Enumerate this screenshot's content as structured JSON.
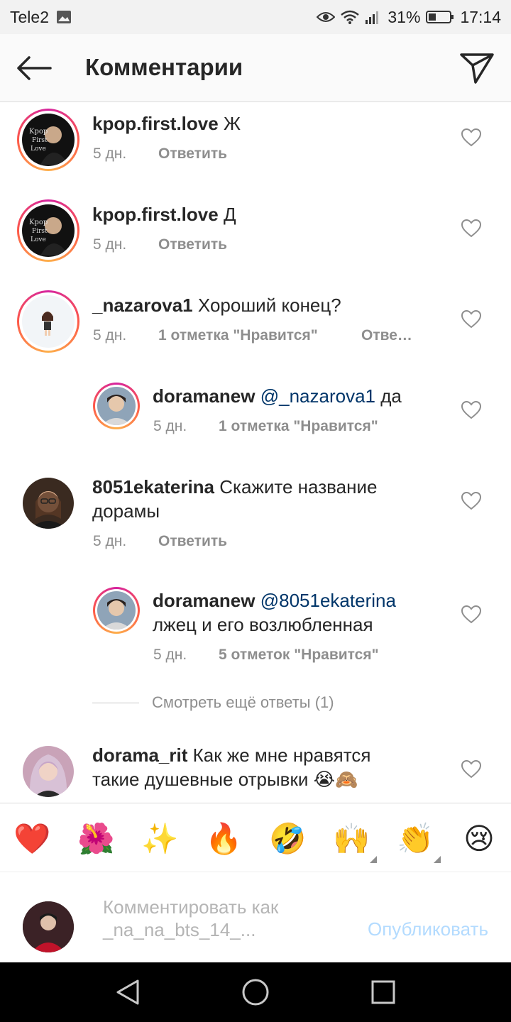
{
  "status_bar": {
    "carrier": "Tele2",
    "battery_percent": "31%",
    "time": "17:14"
  },
  "header": {
    "title": "Комментарии"
  },
  "comments": [
    {
      "username": "kpop.first.love",
      "text": "Ж",
      "time": "5 дн.",
      "action": "Ответить",
      "avatar_label": "Kpop First Love"
    },
    {
      "username": "kpop.first.love",
      "text": "Д",
      "time": "5 дн.",
      "action": "Ответить",
      "avatar_label": "Kpop First Love"
    },
    {
      "username": "_nazarova1",
      "text": "Хороший конец?",
      "time": "5 дн.",
      "likes": "1 отметка \"Нравится\"",
      "action": "Отве…"
    },
    {
      "username": "doramanew",
      "mention": "@_nazarova1",
      "text": "да",
      "time": "5 дн.",
      "likes": "1 отметка \"Нравится\"",
      "reply": true
    },
    {
      "username": "8051ekaterina",
      "text": "Скажите название",
      "text2": "дорамы",
      "time": "5 дн.",
      "action": "Ответить"
    },
    {
      "username": "doramanew",
      "mention": "@8051ekaterina",
      "text2": "лжец и его возлюбленная",
      "time": "5 дн.",
      "likes": "5 отметок \"Нравится\"",
      "reply": true
    },
    {
      "username": "dorama_rit",
      "text": "Как же мне нравятся",
      "text2": "такие душевные отрывки",
      "emojis": "😭🙈"
    }
  ],
  "more_replies": "Смотреть ещё ответы (1)",
  "emoji_bar": [
    "❤️",
    "🌺",
    "✨",
    "🔥",
    "🤣",
    "🙌",
    "👏",
    "😢"
  ],
  "compose": {
    "placeholder_line1": "Комментировать как",
    "placeholder_line2": "_na_na_bts_14_...",
    "publish": "Опубликовать"
  },
  "colors": {
    "username": "#262626",
    "meta": "#8e8e8e",
    "mention": "#003569",
    "publish_disabled": "#b3dbff",
    "ring": "#d6249f"
  }
}
